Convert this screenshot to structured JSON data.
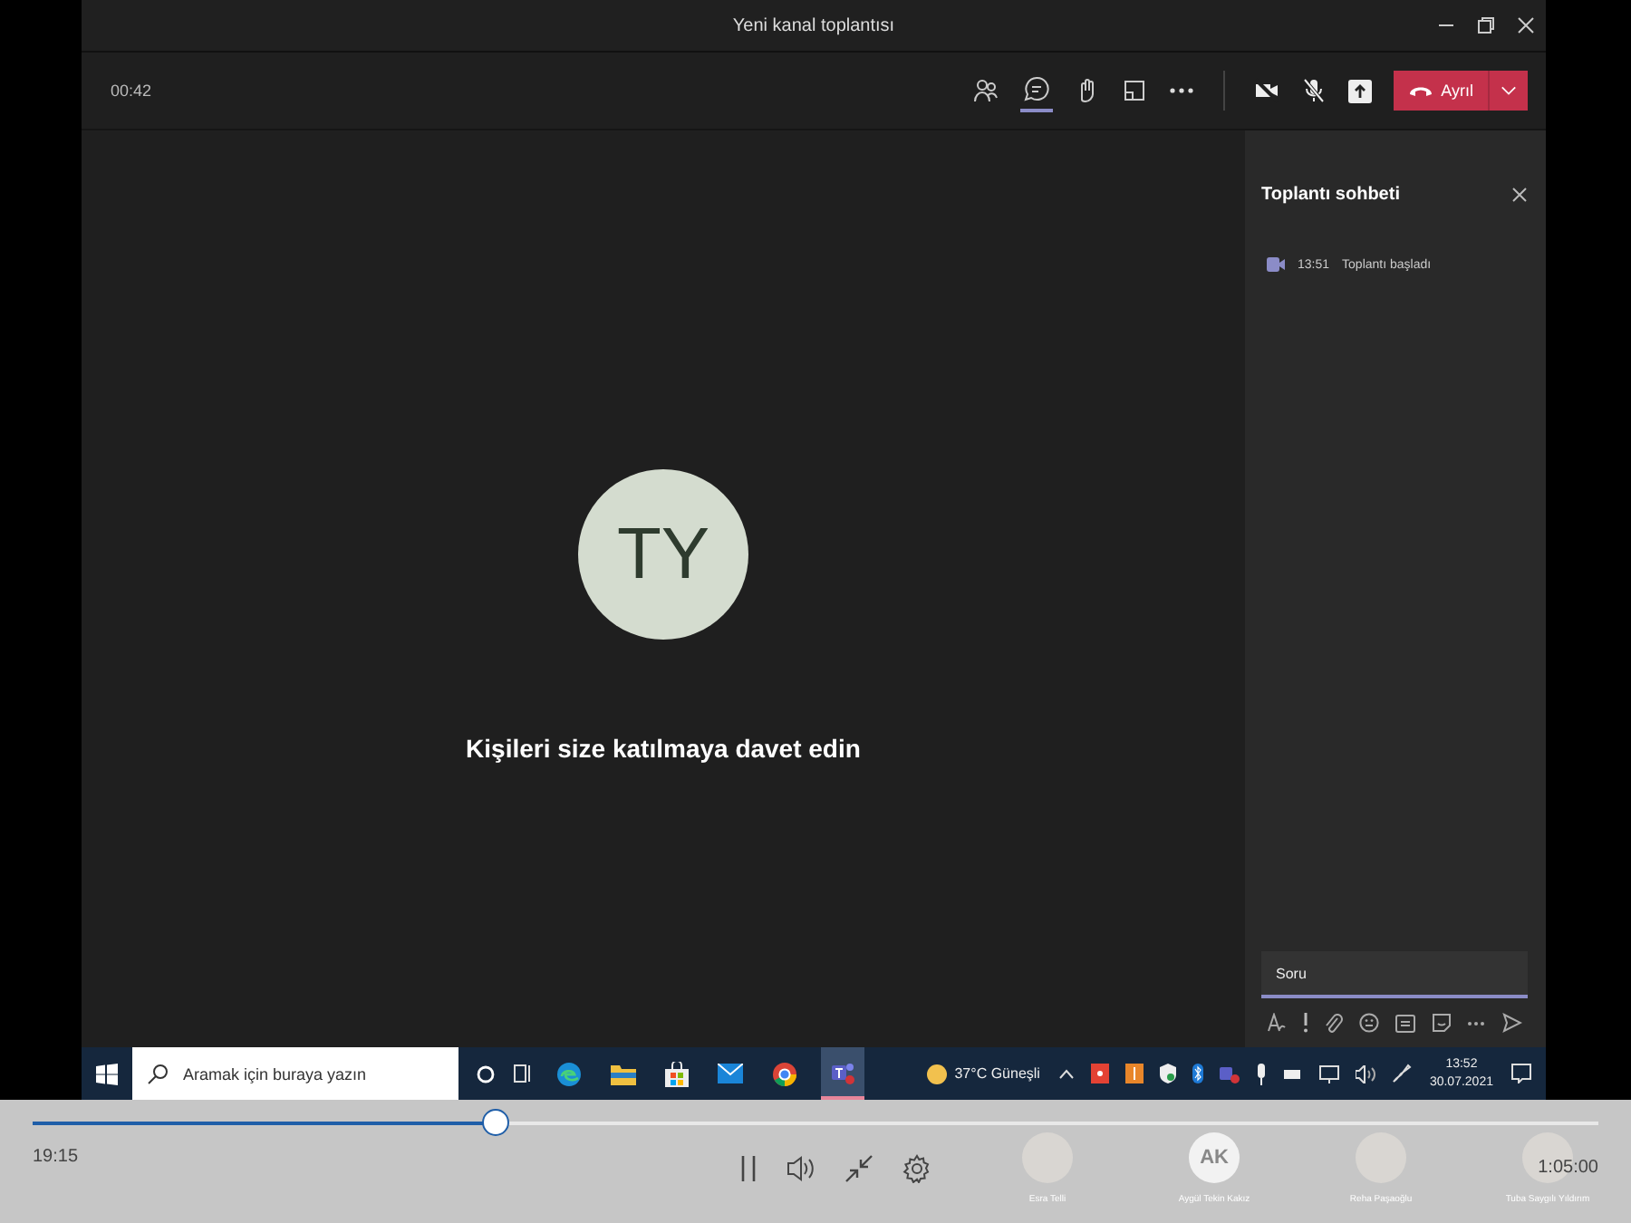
{
  "window": {
    "title": "Yeni kanal toplantısı"
  },
  "call_bar": {
    "timer": "00:42",
    "chat_selected": true,
    "leave_label": "Ayrıl"
  },
  "stage": {
    "initials": "TY",
    "invite_text": "Kişileri size katılmaya davet edin"
  },
  "chat_panel": {
    "title": "Toplantı sohbeti",
    "messages": [
      {
        "time": "13:51",
        "text": "Toplantı başladı"
      }
    ],
    "compose": {
      "value": "Soru"
    }
  },
  "taskbar": {
    "search_placeholder": "Aramak için buraya yazın",
    "weather": "37°C  Güneşli",
    "time": "13:52",
    "date": "30.07.2021"
  },
  "player": {
    "elapsed": "19:15",
    "duration": "1:05:00",
    "level": 0.296,
    "participants": [
      {
        "name": "Esra Telli"
      },
      {
        "name": "Aygül Tekin Kakız",
        "initials": "AK"
      },
      {
        "name": "Reha Paşaoğlu"
      },
      {
        "name": "Tuba Saygılı Yıldırım"
      }
    ]
  }
}
